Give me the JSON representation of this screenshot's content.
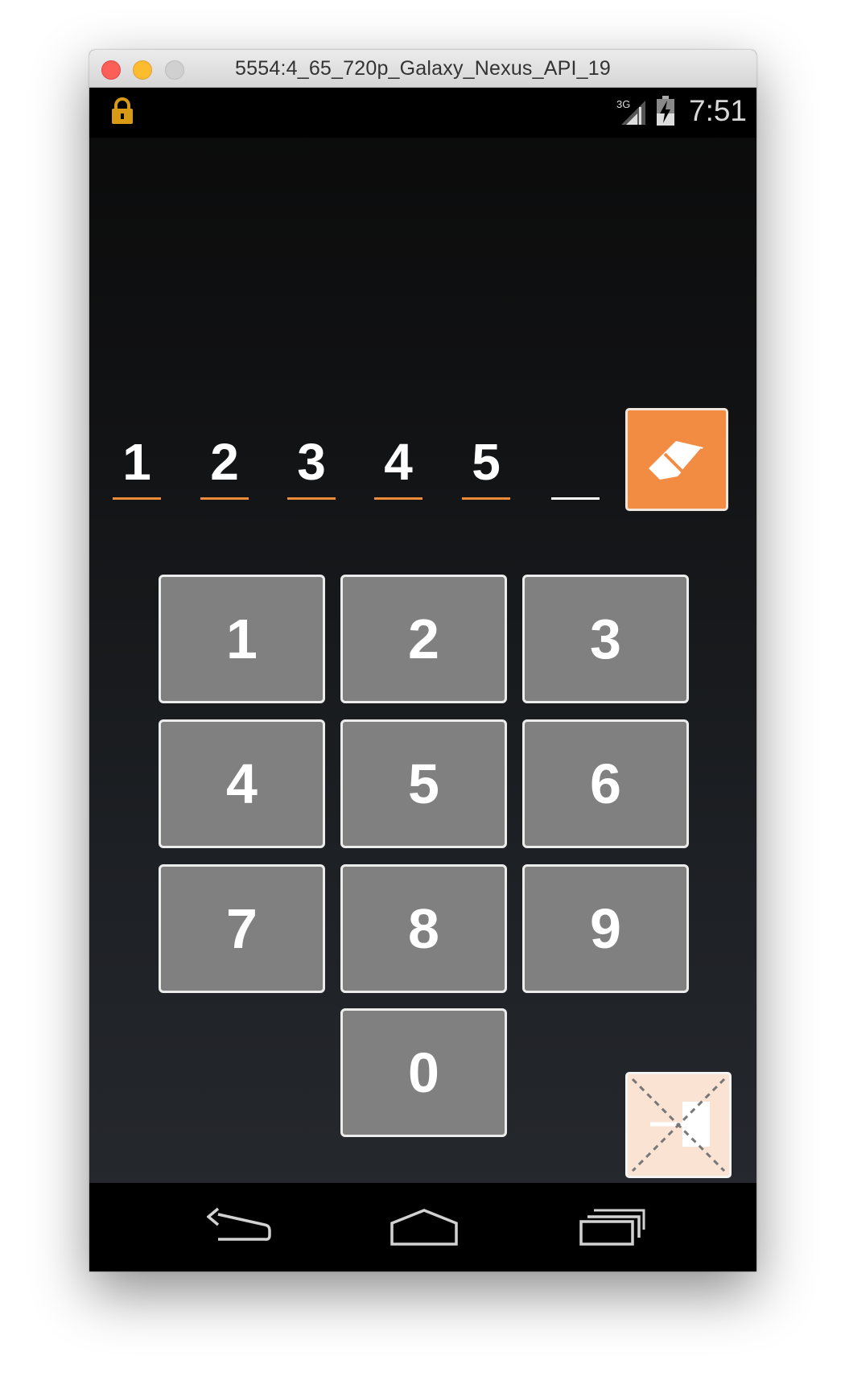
{
  "window": {
    "title": "5554:4_65_720p_Galaxy_Nexus_API_19"
  },
  "statusbar": {
    "network": "3G",
    "time": "7:51"
  },
  "pin": {
    "digits": [
      "1",
      "2",
      "3",
      "4",
      "5",
      ""
    ],
    "accent_color": "#f08b3a"
  },
  "keypad": {
    "keys": [
      "1",
      "2",
      "3",
      "4",
      "5",
      "6",
      "7",
      "8",
      "9",
      "0"
    ],
    "key_color": "#808080"
  },
  "icons": {
    "clear": "eraser-icon",
    "exit": "exit-icon",
    "lock": "lock-icon",
    "back": "back-icon",
    "home": "home-icon",
    "recents": "recents-icon"
  }
}
